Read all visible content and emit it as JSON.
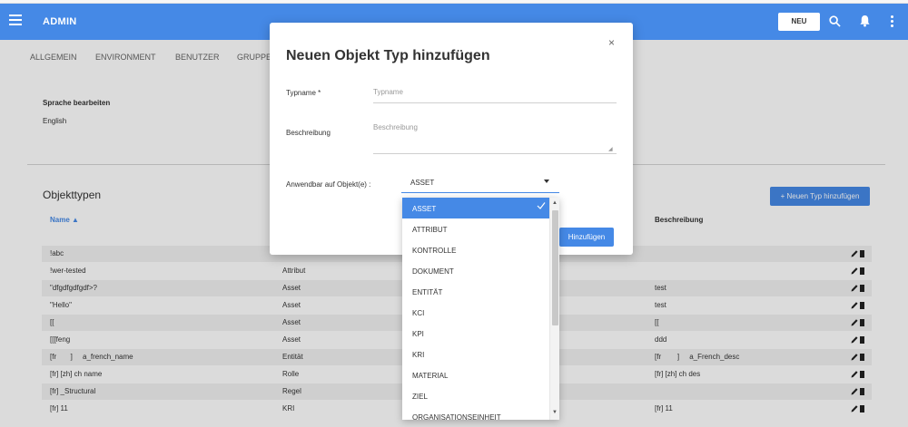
{
  "header": {
    "title": "ADMIN",
    "new_button": "NEU",
    "icons": [
      "menu-icon",
      "search-icon",
      "bell-icon",
      "more-icon"
    ]
  },
  "tabs": [
    "ALLGEMEIN",
    "ENVIRONMENT",
    "BENUTZER",
    "GRUPPE"
  ],
  "language": {
    "title": "Sprache bearbeiten",
    "value": "English"
  },
  "object_types": {
    "title": "Objekttypen",
    "add_button": "+ Neuen Typ hinzufügen",
    "columns": {
      "name": "Name ▲",
      "description": "Beschreibung"
    },
    "rows": [
      {
        "name": "!abc",
        "type": "",
        "desc": ""
      },
      {
        "name": "!wer-tested",
        "type": "Attribut",
        "desc": ""
      },
      {
        "name": "\"dfgdfgdfgdf>?",
        "type": "Asset",
        "desc": "test"
      },
      {
        "name": "\"Hello\"",
        "type": "Asset",
        "desc": "test"
      },
      {
        "name": "[[",
        "type": "Asset",
        "desc": "[["
      },
      {
        "name": "[[[feng",
        "type": "Asset",
        "desc": "ddd"
      },
      {
        "name": "[fr       ]     a_french_name",
        "type": "Entität",
        "desc": "[fr        ]     a_French_desc"
      },
      {
        "name": "[fr] [zh] ch name",
        "type": "Rolle",
        "desc": "[fr] [zh] ch des"
      },
      {
        "name": "[fr] _Structural",
        "type": "Regel",
        "desc": ""
      },
      {
        "name": "[fr] 11",
        "type": "KRI",
        "desc": "[fr] 11"
      }
    ]
  },
  "modal": {
    "title": "Neuen Objekt Typ hinzufügen",
    "typname_label": "Typname *",
    "typname_placeholder": "Typname",
    "desc_label": "Beschreibung",
    "desc_placeholder": "Beschreibung",
    "applicable_label": "Anwendbar auf Objekt(e) :",
    "selected_value": "ASSET",
    "submit_button": "Hinzufügen",
    "close": "×"
  },
  "dropdown_options": [
    "ASSET",
    "ATTRIBUT",
    "KONTROLLE",
    "DOKUMENT",
    "ENTITÄT",
    "KCI",
    "KPI",
    "KRI",
    "MATERIAL",
    "ZIEL",
    "ORGANISATIONSEINHEIT"
  ],
  "colors": {
    "primary": "#4589e6",
    "row_alt": "#f2f2f2"
  }
}
